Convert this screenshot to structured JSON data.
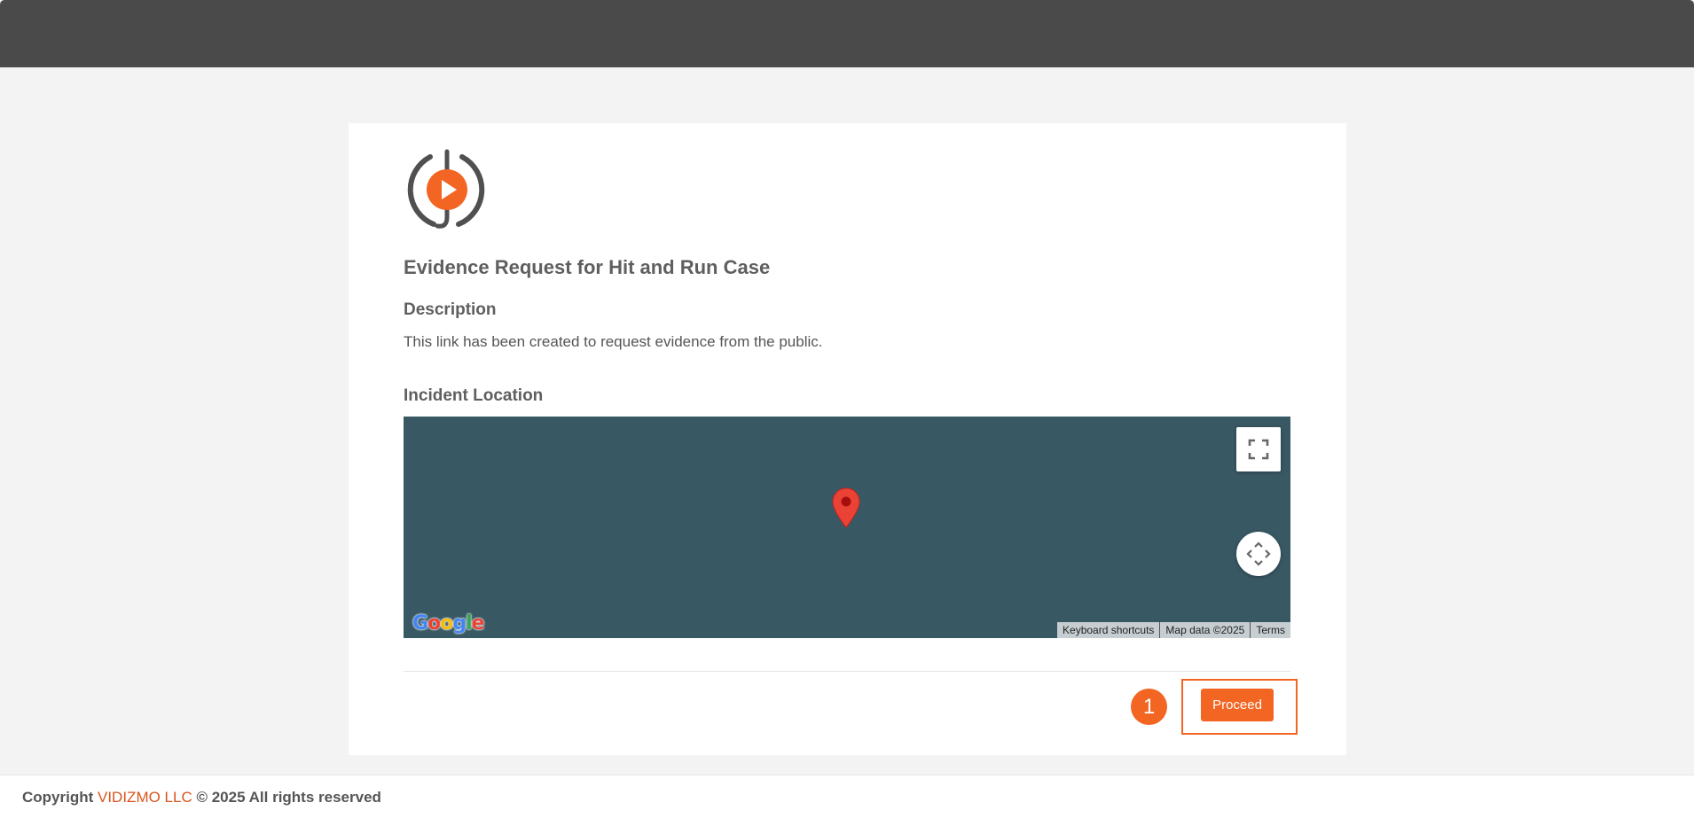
{
  "header": {},
  "card": {
    "title": "Evidence Request for Hit and Run Case",
    "description_label": "Description",
    "description_text": "This link has been created to request evidence from the public.",
    "location_label": "Incident Location"
  },
  "map": {
    "attribution": {
      "keyboard_shortcuts": "Keyboard shortcuts",
      "map_data": "Map data ©2025",
      "terms": "Terms"
    },
    "background_color": "#385864",
    "pin_color": "#ea4335"
  },
  "actions": {
    "step_number": "1",
    "proceed_label": "Proceed"
  },
  "footer": {
    "prefix": "Copyright ",
    "company": "VIDIZMO LLC",
    "suffix": " © 2025 All rights reserved"
  },
  "colors": {
    "accent": "#f26522",
    "header_bg": "#4a4a4a",
    "page_bg": "#f3f3f3"
  }
}
